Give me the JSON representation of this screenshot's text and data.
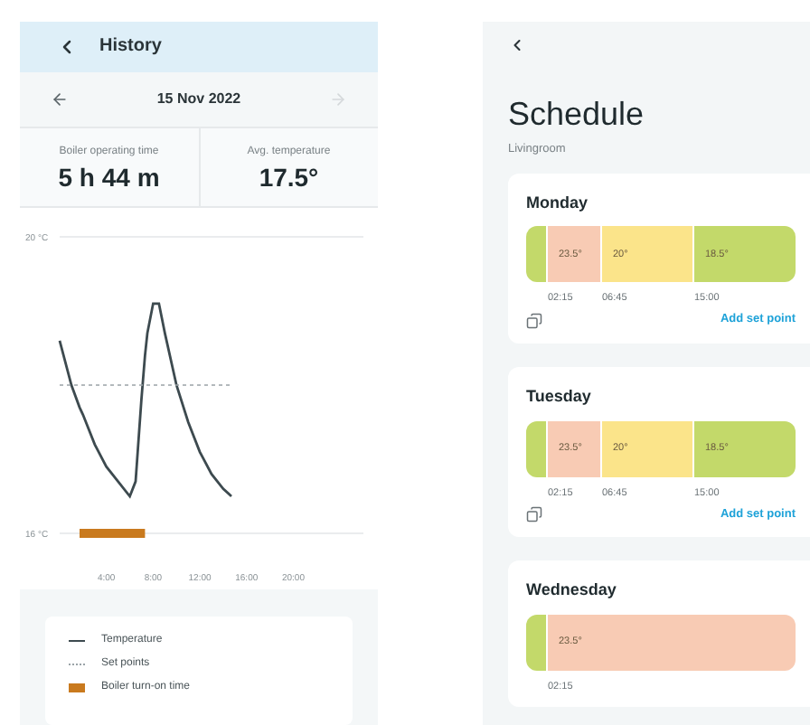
{
  "history": {
    "title": "History",
    "date": "15 Nov 2022",
    "prev_disabled": false,
    "next_disabled": true,
    "stats": [
      {
        "label": "Boiler operating time",
        "value": "5 h 44 m"
      },
      {
        "label": "Avg. temperature",
        "value": "17.5°"
      }
    ],
    "chart_data": {
      "type": "line",
      "x": [
        0,
        1,
        1.7,
        2,
        3,
        4,
        5,
        6,
        6.5,
        7,
        7.3,
        7.5,
        8,
        8.5,
        9,
        10,
        11,
        12,
        13,
        14,
        14.7
      ],
      "series": [
        {
          "name": "Temperature",
          "color": "#3d4a4f",
          "line_style": "solid",
          "values": [
            18.6,
            18.0,
            17.7,
            17.6,
            17.2,
            16.9,
            16.7,
            16.5,
            16.7,
            17.8,
            18.4,
            18.7,
            19.1,
            19.1,
            18.7,
            18.0,
            17.5,
            17.1,
            16.8,
            16.6,
            16.5
          ]
        },
        {
          "name": "Set points",
          "color": "#9aa3a7",
          "line_style": "dotted",
          "values": [
            18.0,
            18.0,
            18.0,
            18.0,
            18.0,
            18.0,
            18.0,
            18.0,
            18.0,
            18.0,
            18.0,
            18.0,
            18.0,
            18.0,
            18.0,
            18.0,
            18.0,
            18.0,
            18.0,
            18.0,
            18.0
          ]
        },
        {
          "name": "Boiler turn-on time",
          "color": "#c97a1e",
          "line_style": "solid",
          "values": [
            null,
            null,
            16,
            16,
            16,
            16,
            16,
            16,
            16,
            16,
            16,
            null,
            null,
            null,
            null,
            null,
            null,
            null,
            null,
            null,
            null
          ]
        }
      ],
      "xlim": [
        0,
        26
      ],
      "ylim": [
        16,
        20
      ],
      "xticks": [
        {
          "value": 4,
          "label": "4:00"
        },
        {
          "value": 8,
          "label": "8:00"
        },
        {
          "value": 12,
          "label": "12:00"
        },
        {
          "value": 16,
          "label": "16:00"
        },
        {
          "value": 20,
          "label": "20:00"
        }
      ],
      "yticks": [
        {
          "value": 16,
          "label": "16 °C"
        },
        {
          "value": 20,
          "label": "20 °C"
        }
      ]
    }
  },
  "schedule": {
    "title": "Schedule",
    "room": "Livingroom",
    "days": [
      {
        "name": "Monday",
        "segments": [
          {
            "color": "#c3d96a"
          },
          {
            "color": "#f8cbb4",
            "temp": "23.5°",
            "time": "02:15"
          },
          {
            "color": "#fbe48a",
            "temp": "20°",
            "time": "06:45"
          },
          {
            "color": "#c3d96a",
            "temp": "18.5°",
            "time": "15:00"
          }
        ],
        "action": "Add set point"
      },
      {
        "name": "Tuesday",
        "segments": [
          {
            "color": "#c3d96a"
          },
          {
            "color": "#f8cbb4",
            "temp": "23.5°",
            "time": "02:15"
          },
          {
            "color": "#fbe48a",
            "temp": "20°",
            "time": "06:45"
          },
          {
            "color": "#c3d96a",
            "temp": "18.5°",
            "time": "15:00"
          }
        ],
        "action": "Add set point"
      },
      {
        "name": "Wednesday",
        "segments": [
          {
            "color": "#c3d96a"
          },
          {
            "color": "#f8cbb4",
            "temp": "23.5°",
            "time": "02:15"
          }
        ]
      }
    ]
  }
}
